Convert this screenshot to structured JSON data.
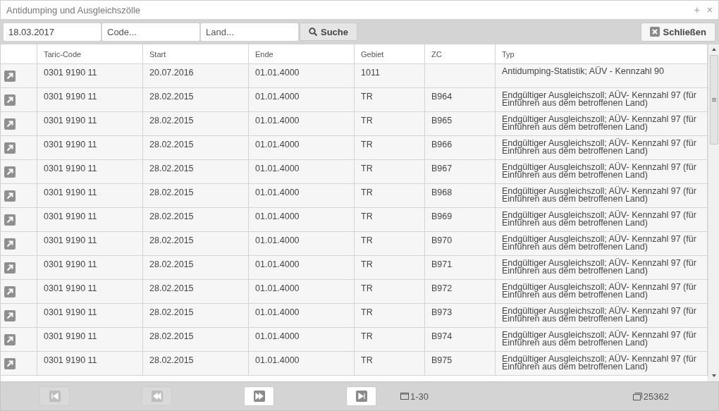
{
  "window": {
    "title": "Antidumping und Ausgleichszölle",
    "buttons": [
      "+",
      "×"
    ]
  },
  "toolbar": {
    "date": {
      "value": "18.03.2017"
    },
    "code": {
      "placeholder": "Code..."
    },
    "land": {
      "placeholder": "Land..."
    },
    "search_button": "Suche",
    "close_button": "Schließen"
  },
  "table": {
    "columns": [
      "Taric-Code",
      "Start",
      "Ende",
      "Gebiet",
      "ZC",
      "Typ"
    ],
    "rows": [
      {
        "cells": [
          "0301 9190 11",
          "20.07.2016",
          "01.01.4000",
          "1011",
          "",
          "Antidumping-Statistik; AÜV - Kennzahl 90"
        ]
      },
      {
        "cells": [
          "0301 9190 11",
          "28.02.2015",
          "01.01.4000",
          "TR",
          "B964",
          "Endgültiger Ausgleichszoll; AÜV- Kennzahl 97 (für Einführen aus dem betroffenen Land)"
        ]
      },
      {
        "cells": [
          "0301 9190 11",
          "28.02.2015",
          "01.01.4000",
          "TR",
          "B965",
          "Endgültiger Ausgleichszoll; AÜV- Kennzahl 97 (für Einführen aus dem betroffenen Land)"
        ]
      },
      {
        "cells": [
          "0301 9190 11",
          "28.02.2015",
          "01.01.4000",
          "TR",
          "B966",
          "Endgültiger Ausgleichszoll; AÜV- Kennzahl 97 (für Einführen aus dem betroffenen Land)"
        ]
      },
      {
        "cells": [
          "0301 9190 11",
          "28.02.2015",
          "01.01.4000",
          "TR",
          "B967",
          "Endgültiger Ausgleichszoll; AÜV- Kennzahl 97 (für Einführen aus dem betroffenen Land)"
        ]
      },
      {
        "cells": [
          "0301 9190 11",
          "28.02.2015",
          "01.01.4000",
          "TR",
          "B968",
          "Endgültiger Ausgleichszoll; AÜV- Kennzahl 97 (für Einführen aus dem betroffenen Land)"
        ]
      },
      {
        "cells": [
          "0301 9190 11",
          "28.02.2015",
          "01.01.4000",
          "TR",
          "B969",
          "Endgültiger Ausgleichszoll; AÜV- Kennzahl 97 (für Einführen aus dem betroffenen Land)"
        ]
      },
      {
        "cells": [
          "0301 9190 11",
          "28.02.2015",
          "01.01.4000",
          "TR",
          "B970",
          "Endgültiger Ausgleichszoll; AÜV- Kennzahl 97 (für Einführen aus dem betroffenen Land)"
        ]
      },
      {
        "cells": [
          "0301 9190 11",
          "28.02.2015",
          "01.01.4000",
          "TR",
          "B971",
          "Endgültiger Ausgleichszoll; AÜV- Kennzahl 97 (für Einführen aus dem betroffenen Land)"
        ]
      },
      {
        "cells": [
          "0301 9190 11",
          "28.02.2015",
          "01.01.4000",
          "TR",
          "B972",
          "Endgültiger Ausgleichszoll; AÜV- Kennzahl 97 (für Einführen aus dem betroffenen Land)"
        ]
      },
      {
        "cells": [
          "0301 9190 11",
          "28.02.2015",
          "01.01.4000",
          "TR",
          "B973",
          "Endgültiger Ausgleichszoll; AÜV- Kennzahl 97 (für Einführen aus dem betroffenen Land)"
        ]
      },
      {
        "cells": [
          "0301 9190 11",
          "28.02.2015",
          "01.01.4000",
          "TR",
          "B974",
          "Endgültiger Ausgleichszoll; AÜV- Kennzahl 97 (für Einführen aus dem betroffenen Land)"
        ]
      },
      {
        "cells": [
          "0301 9190 11",
          "28.02.2015",
          "01.01.4000",
          "TR",
          "B975",
          "Endgültiger Ausgleichszoll; AÜV- Kennzahl 97 (für Einführen aus dem betroffenen Land)"
        ]
      }
    ]
  },
  "pager": {
    "buttons": [
      {
        "kind": "first",
        "disabled": true
      },
      {
        "kind": "prev",
        "disabled": true
      },
      {
        "kind": "next",
        "disabled": false
      },
      {
        "kind": "last",
        "disabled": false
      }
    ],
    "range": "1-30",
    "total": "25362"
  }
}
